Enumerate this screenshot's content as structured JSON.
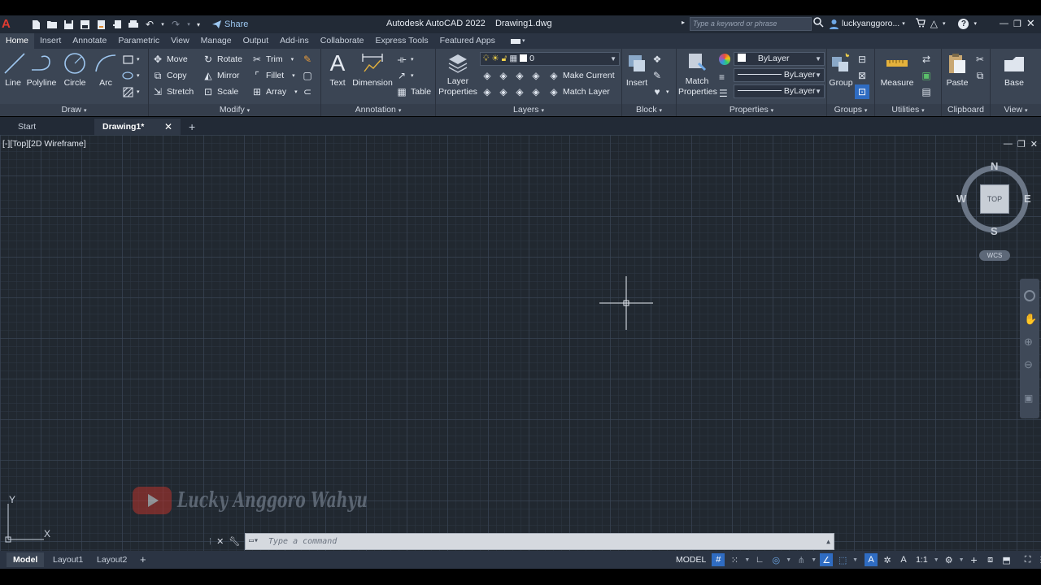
{
  "title_bar": {
    "app_title": "Autodesk AutoCAD 2022",
    "file_name": "Drawing1.dwg",
    "share_label": "Share",
    "search_placeholder": "Type a keyword or phrase",
    "user_name": "luckyanggoro..."
  },
  "ribbon_tabs": [
    "Home",
    "Insert",
    "Annotate",
    "Parametric",
    "View",
    "Manage",
    "Output",
    "Add-ins",
    "Collaborate",
    "Express Tools",
    "Featured Apps"
  ],
  "ribbon": {
    "draw": {
      "title": "Draw",
      "line": "Line",
      "polyline": "Polyline",
      "circle": "Circle",
      "arc": "Arc"
    },
    "modify": {
      "title": "Modify",
      "move": "Move",
      "rotate": "Rotate",
      "trim": "Trim",
      "copy": "Copy",
      "mirror": "Mirror",
      "fillet": "Fillet",
      "stretch": "Stretch",
      "scale": "Scale",
      "array": "Array"
    },
    "annotation": {
      "title": "Annotation",
      "text": "Text",
      "dimension": "Dimension",
      "table": "Table"
    },
    "layers": {
      "title": "Layers",
      "properties_line1": "Layer",
      "properties_line2": "Properties",
      "current_layer": "0",
      "make_current": "Make Current",
      "match_layer": "Match Layer"
    },
    "block": {
      "title": "Block",
      "insert": "Insert"
    },
    "properties": {
      "title": "Properties",
      "match_line1": "Match",
      "match_line2": "Properties",
      "color": "ByLayer",
      "linetype": "ByLayer",
      "lineweight": "ByLayer"
    },
    "groups": {
      "title": "Groups",
      "group": "Group"
    },
    "utilities": {
      "title": "Utilities",
      "measure": "Measure"
    },
    "clipboard": {
      "title": "Clipboard",
      "paste": "Paste"
    },
    "view": {
      "title": "View",
      "base": "Base"
    }
  },
  "file_tabs": {
    "start": "Start",
    "drawing": "Drawing1*"
  },
  "viewport": {
    "label": "[-][Top][2D Wireframe]",
    "compass": {
      "n": "N",
      "s": "S",
      "e": "E",
      "w": "W",
      "top": "TOP"
    },
    "wcs": "WCS",
    "ucs_x": "X",
    "ucs_y": "Y",
    "watermark": "Lucky Anggoro Wahyu"
  },
  "command_line": {
    "placeholder": "Type a command"
  },
  "layout_tabs": [
    "Model",
    "Layout1",
    "Layout2"
  ],
  "status_bar": {
    "model": "MODEL",
    "scale": "1:1"
  },
  "colors": {
    "accent": "#2f6cc2",
    "background": "#212830",
    "ribbon": "#3b4554",
    "logo": "#e03c31"
  }
}
